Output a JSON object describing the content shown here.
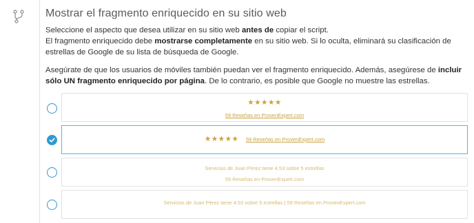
{
  "section": {
    "title": "Mostrar el fragmento enriquecido en su sitio web",
    "p1": {
      "a": "Seleccione el aspecto que desea utilizar en su sitio web ",
      "b": "antes de",
      "c": " copiar el script.",
      "d": "El fragmento enriquecido debe ",
      "e": "mostrarse completamente",
      "f": " en su sitio web. Si lo oculta, eliminará su clasificación de estrellas de Google de su lista de búsqueda de Google."
    },
    "p2": {
      "a": "Asegúrate de que los usuarios de móviles también puedan ver el fragmento enriquecido. Además, asegúrese de ",
      "b": "incluir sólo UN fragmento enriquecido por página",
      "c": ". De lo contrario, es posible que Google no muestre las estrellas."
    }
  },
  "options": [
    {
      "stars": "★★★★★",
      "link": "59 Reseñas en ProvenExpert.com",
      "selected": false
    },
    {
      "stars": "★★★★★",
      "link": "59 Reseñas en ProvenExpert.com",
      "selected": true
    },
    {
      "line1": "Servicios de Juan Pérez tiene 4.53 sobre 5 estrellas",
      "line2": "59 Reseñas en ProvenExpert.com",
      "selected": false
    },
    {
      "line1": "Servicios de Juan Pérez tiene 4.53 sobre 5 estrellas | 59 Reseñas en ProvenExpert.com",
      "selected": false
    }
  ],
  "colors": {
    "accent": "#2c9ad3",
    "gold": "#c9a13e"
  },
  "icons": {
    "section": "branch-icon",
    "check": "check-icon"
  }
}
